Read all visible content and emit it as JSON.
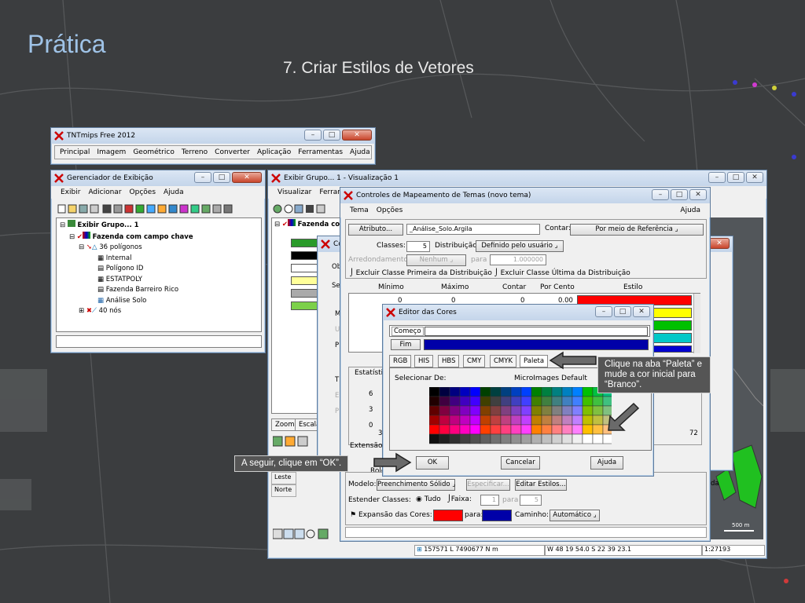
{
  "slide": {
    "title": "Prática",
    "subtitle": "7. Criar Estilos de Vetores"
  },
  "tnt_main": {
    "title": "TNTmips Free 2012",
    "menu": [
      "Principal",
      "Imagem",
      "Geométrico",
      "Terreno",
      "Converter",
      "Aplicação",
      "Ferramentas",
      "Ajuda"
    ]
  },
  "display_manager": {
    "title": "Gerenciador de Exibição",
    "menu": [
      "Exibir",
      "Adicionar",
      "Opções",
      "Ajuda"
    ],
    "tree": {
      "group": "Exibir Grupo... 1",
      "layer": "Fazenda com campo chave",
      "polygons": "36 polígonos",
      "tables": [
        "Internal",
        "Polígono ID",
        "ESTATPOLY",
        "Fazenda Barreiro Rico",
        "Análise Solo"
      ],
      "nodes": "40 nós"
    }
  },
  "view_window": {
    "title": "Exibir Grupo... 1 - Visualização 1",
    "menu": [
      "Visualizar",
      "Ferram"
    ],
    "layer_label": "Fazenda co",
    "zoom_tab": "Zoom",
    "scale_tab": "Escala",
    "rows": [
      "Leste",
      "Norte"
    ],
    "status": {
      "coords_proj": "157571 L 7490677 N m",
      "coords_geo": "W 48 19 54.0  S 22 39 23.1",
      "scale": "1:27193",
      "scalebar": "500 m"
    }
  },
  "theme_mapping": {
    "title": "Controles de Mapeamento de Temas (novo tema)",
    "menu": [
      "Tema",
      "Opções"
    ],
    "help": "Ajuda",
    "attribute_btn": "Atributo...",
    "attribute_value": "_Análise_Solo.Argila",
    "count_label": "Contar:",
    "count_value": "Por meio de Referência",
    "classes_label": "Classes:",
    "classes_value": "5",
    "distribution_label": "Distribuição:",
    "distribution_value": "Definido pelo usuário",
    "rounding_label": "Arredondamento:",
    "rounding_value": "Nenhum",
    "for_label": "para",
    "rounding_for": "1.000000",
    "exclude_first": "Excluir Classe Primeira da Distribuição",
    "exclude_last": "Excluir Classe Última da Distribuição",
    "table_headers": [
      "Mínimo",
      "Máximo",
      "Contar",
      "Por Cento",
      "Estilo"
    ],
    "first_row": {
      "min": "0",
      "max": "0",
      "count": "0",
      "percent": "0.00"
    },
    "class_colors": [
      "#ff0000",
      "#ffff00",
      "#00c000",
      "#00c8c8",
      "#0000d0"
    ],
    "right_value": "72",
    "model_label": "Modelo:",
    "model_value": "Preenchimento Sólido",
    "specify_btn": "Especificar...",
    "edit_styles_btn": "Editar Estilos...",
    "extend_label": "Estender Classes:",
    "extend_all": "Tudo",
    "extend_range": "Faixa:",
    "extend_from": "1",
    "extend_to": "5",
    "expansion_label": "Expansão das Cores:",
    "expansion_to": "para:",
    "path_label": "Caminho:",
    "path_value": "Automático",
    "color_from": "#ff0000",
    "color_to": "#0000a8"
  },
  "background_dialog": {
    "labels": [
      "Ob",
      "Se",
      "M",
      "U",
      "P",
      "T",
      "E",
      "P"
    ],
    "stats_label": "Estatísticas",
    "axis_ticks": [
      "6",
      "3",
      "0"
    ],
    "axis_min": "34",
    "extension_label": "Extensão:",
    "ro_labels": [
      "Ro",
      "Ro"
    ],
    "reference_label": "Role",
    "right_label": "da"
  },
  "color_editor": {
    "title": "Editor das Cores",
    "start_label": "Começo",
    "end_label": "Fim",
    "end_color": "#0000a8",
    "tabs": [
      "RGB",
      "HIS",
      "HBS",
      "CMY",
      "CMYK",
      "Paleta"
    ],
    "select_from_label": "Selecionar De:",
    "select_from_value": "MicroImages Default",
    "ok_btn": "OK",
    "cancel_btn": "Cancelar",
    "help_btn": "Ajuda"
  },
  "callouts": {
    "palette_note": "Clique na aba “Paleta” e mude a cor inicial para “Branco”.",
    "ok_note": "A seguir, clique em “OK”."
  }
}
